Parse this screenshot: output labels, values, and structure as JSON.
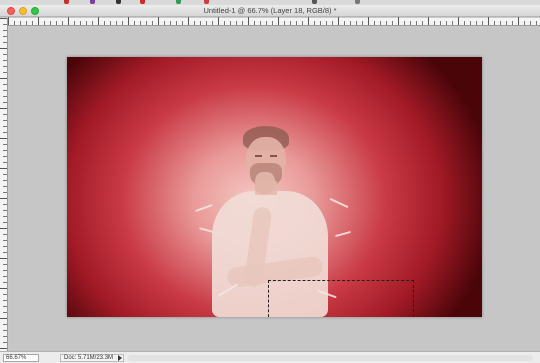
{
  "window": {
    "title": "Untitled-1 @ 66.7% (Layer 18, RGB/8) *"
  },
  "tabstrip": {
    "tab_colors": [
      "#c9302c",
      "#7a3fa0",
      "#2b6cb0",
      "#333333",
      "#cf2a2a",
      "#2f9d55",
      "#d23b3b"
    ]
  },
  "status_bar": {
    "zoom_value": "66.67%",
    "doc_info": "Doc: 5.71M/23.3M"
  },
  "canvas": {
    "background_colors": [
      "#f4c9c2",
      "#c93a45",
      "#4a0509"
    ],
    "has_selection": true
  }
}
